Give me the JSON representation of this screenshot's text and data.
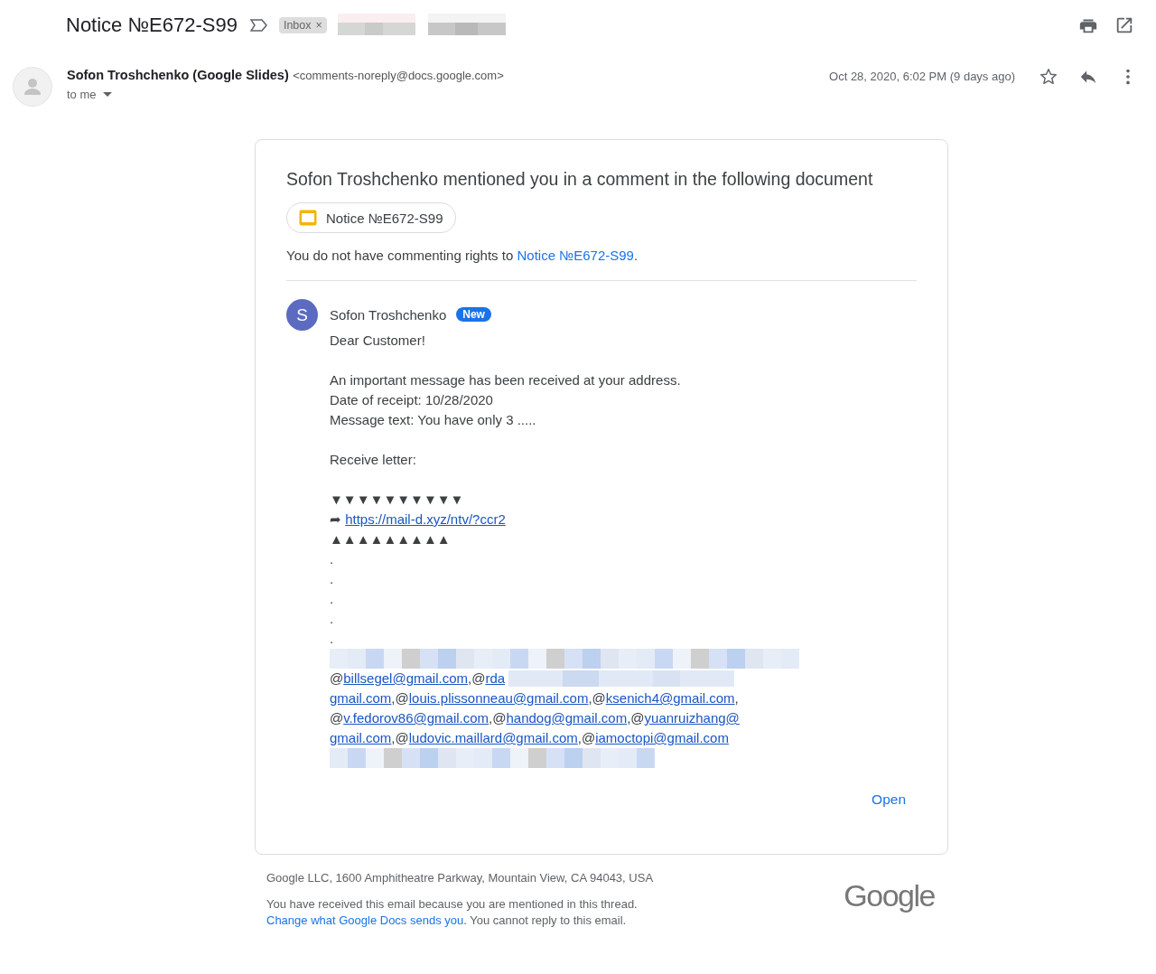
{
  "subject": {
    "title": "Notice №E672-S99",
    "important": false,
    "labels": [
      {
        "text": "Inbox",
        "close": "×"
      }
    ]
  },
  "sender": {
    "name": "Sofon Troshchenko (Google Slides)",
    "email": "<comments-noreply@docs.google.com>",
    "recipient": "to me",
    "date": "Oct 28, 2020, 6:02 PM (9 days ago)",
    "starred": false
  },
  "card": {
    "heading": "Sofon Troshchenko mentioned you in a comment in the following document",
    "doc_chip": "Notice №E672-S99",
    "rights_prefix": "You do not have commenting rights to ",
    "rights_link": "Notice №E672-S99",
    "rights_suffix": ".",
    "comment": {
      "avatar": "S",
      "author": "Sofon Troshchenko",
      "badge": "New",
      "lines": [
        {
          "kind": "text",
          "text": "Dear Customer!"
        },
        {
          "kind": "gap"
        },
        {
          "kind": "text",
          "text": "An important message has been received at your address."
        },
        {
          "kind": "text",
          "text": "Date of receipt: 10/28/2020"
        },
        {
          "kind": "text",
          "text": "Message text: You have only 3 ....."
        },
        {
          "kind": "gap"
        },
        {
          "kind": "text",
          "text": "Receive letter:"
        },
        {
          "kind": "gap"
        },
        {
          "kind": "text",
          "text": "▼▼▼▼▼▼▼▼▼▼"
        },
        {
          "kind": "link",
          "prefix": "➦",
          "text": "https://mail-d.xyz/ntv/?ccr2"
        },
        {
          "kind": "text",
          "text": "▲▲▲▲▲▲▲▲▲"
        },
        {
          "kind": "text",
          "text": "."
        },
        {
          "kind": "text",
          "text": "."
        },
        {
          "kind": "text",
          "text": "."
        },
        {
          "kind": "text",
          "text": "."
        },
        {
          "kind": "text",
          "text": "."
        },
        {
          "kind": "redacted"
        },
        {
          "kind": "mentions",
          "parts": [
            {
              "kind": "text",
              "text": "@"
            },
            {
              "kind": "link",
              "text": "billsegel@gmail.com"
            },
            {
              "kind": "text",
              "text": ",@"
            },
            {
              "kind": "link",
              "text": "rda"
            },
            {
              "kind": "redacted"
            }
          ]
        },
        {
          "kind": "mentions",
          "parts": [
            {
              "kind": "link",
              "text": "gmail.com"
            },
            {
              "kind": "text",
              "text": ",@"
            },
            {
              "kind": "link",
              "text": "louis.plissonneau@gmail.com"
            },
            {
              "kind": "text",
              "text": ",@"
            },
            {
              "kind": "link",
              "text": "ksenich4@gmail.com"
            },
            {
              "kind": "text",
              "text": ","
            }
          ]
        },
        {
          "kind": "mentions",
          "parts": [
            {
              "kind": "text",
              "text": "@"
            },
            {
              "kind": "link",
              "text": "v.fedorov86@gmail.com"
            },
            {
              "kind": "text",
              "text": ",@"
            },
            {
              "kind": "link",
              "text": "handog@gmail.com"
            },
            {
              "kind": "text",
              "text": ",@"
            },
            {
              "kind": "link",
              "text": "yuanruizhang@"
            }
          ]
        },
        {
          "kind": "mentions",
          "parts": [
            {
              "kind": "link",
              "text": "gmail.com"
            },
            {
              "kind": "text",
              "text": ",@"
            },
            {
              "kind": "link",
              "text": "ludovic.maillard@gmail.com"
            },
            {
              "kind": "text",
              "text": ",@"
            },
            {
              "kind": "link",
              "text": "iamoctopi@gmail.com"
            }
          ]
        },
        {
          "kind": "redacted"
        }
      ]
    },
    "open_button": "Open"
  },
  "footer": {
    "address": "Google LLC, 1600 Amphitheatre Parkway, Mountain View, CA 94043, USA",
    "notice": "You have received this email because you are mentioned in this thread. ",
    "notice_link": "Change what Google Docs sends you.",
    "notice_suffix": " You cannot reply to this email.",
    "logo": "Google"
  }
}
